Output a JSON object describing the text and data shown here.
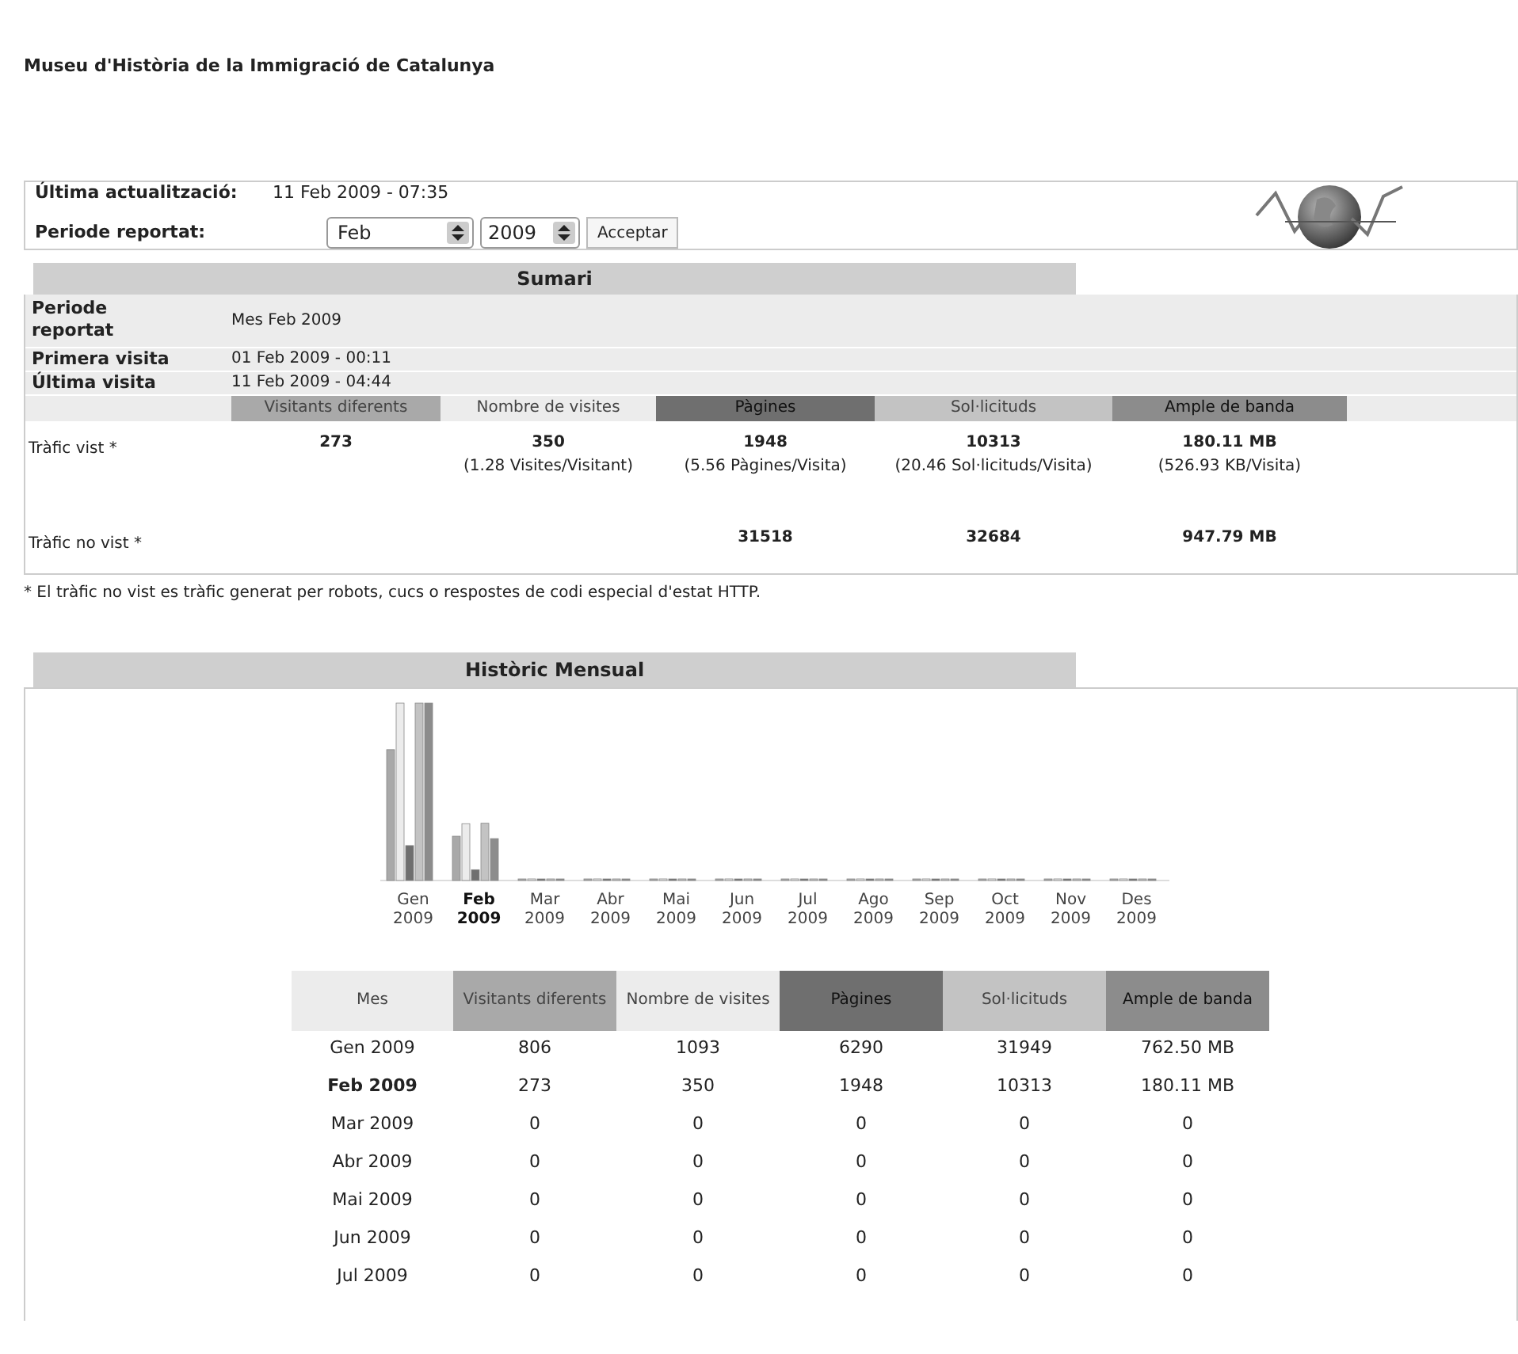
{
  "page_title": "Museu d'Història de la Immigració de Catalunya",
  "header": {
    "updated_label": "Última actualització:",
    "updated_value": "11 Feb 2009 - 07:35",
    "period_label": "Periode reportat:",
    "month_select": "Feb",
    "year_select": "2009",
    "accept_button": "Acceptar"
  },
  "summary": {
    "title": "Sumari",
    "info_rows": [
      {
        "label": "Periode reportat",
        "value": "Mes Feb 2009"
      },
      {
        "label": "Primera visita",
        "value": "01 Feb 2009 - 00:11"
      },
      {
        "label": "Última visita",
        "value": "11 Feb 2009 - 04:44"
      }
    ],
    "columns": [
      {
        "label": "Visitants diferents",
        "color": "#a9a9a9"
      },
      {
        "label": "Nombre de visites",
        "color": "#ececec"
      },
      {
        "label": "Pàgines",
        "color": "#6f6f6f"
      },
      {
        "label": "Sol·licituds",
        "color": "#c3c3c3"
      },
      {
        "label": "Ample de banda",
        "color": "#8c8c8c"
      }
    ],
    "rows": [
      {
        "label": "Tràfic vist *",
        "cells": [
          {
            "value": "273"
          },
          {
            "value": "350",
            "detail": "(1.28 Visites/Visitant)"
          },
          {
            "value": "1948",
            "detail": "(5.56 Pàgines/Visita)"
          },
          {
            "value": "10313",
            "detail": "(20.46 Sol·licituds/Visita)"
          },
          {
            "value": "180.11 MB",
            "detail": "(526.93 KB/Visita)"
          }
        ]
      },
      {
        "label": "Tràfic no vist *",
        "cells": [
          null,
          null,
          {
            "value": "31518"
          },
          {
            "value": "32684"
          },
          {
            "value": "947.79 MB"
          }
        ]
      }
    ],
    "footnote": "* El tràfic no vist es tràfic generat per robots, cucs o respostes de codi especial d'estat HTTP."
  },
  "history": {
    "title": "Històric Mensual",
    "chart_months": [
      {
        "month": "Gen",
        "year": "2009",
        "selected": false
      },
      {
        "month": "Feb",
        "year": "2009",
        "selected": true
      },
      {
        "month": "Mar",
        "year": "2009",
        "selected": false
      },
      {
        "month": "Abr",
        "year": "2009",
        "selected": false
      },
      {
        "month": "Mai",
        "year": "2009",
        "selected": false
      },
      {
        "month": "Jun",
        "year": "2009",
        "selected": false
      },
      {
        "month": "Jul",
        "year": "2009",
        "selected": false
      },
      {
        "month": "Ago",
        "year": "2009",
        "selected": false
      },
      {
        "month": "Sep",
        "year": "2009",
        "selected": false
      },
      {
        "month": "Oct",
        "year": "2009",
        "selected": false
      },
      {
        "month": "Nov",
        "year": "2009",
        "selected": false
      },
      {
        "month": "Des",
        "year": "2009",
        "selected": false
      }
    ],
    "columns": [
      {
        "label": "Mes",
        "color": "#ececec"
      },
      {
        "label": "Visitants diferents",
        "color": "#a9a9a9"
      },
      {
        "label": "Nombre de visites",
        "color": "#ececec"
      },
      {
        "label": "Pàgines",
        "color": "#6f6f6f"
      },
      {
        "label": "Sol·licituds",
        "color": "#c3c3c3"
      },
      {
        "label": "Ample de banda",
        "color": "#8c8c8c"
      }
    ],
    "rows": [
      {
        "month": "Gen 2009",
        "selected": false,
        "values": [
          "806",
          "1093",
          "6290",
          "31949",
          "762.50 MB"
        ]
      },
      {
        "month": "Feb 2009",
        "selected": true,
        "values": [
          "273",
          "350",
          "1948",
          "10313",
          "180.11 MB"
        ]
      },
      {
        "month": "Mar 2009",
        "selected": false,
        "values": [
          "0",
          "0",
          "0",
          "0",
          "0"
        ]
      },
      {
        "month": "Abr 2009",
        "selected": false,
        "values": [
          "0",
          "0",
          "0",
          "0",
          "0"
        ]
      },
      {
        "month": "Mai 2009",
        "selected": false,
        "values": [
          "0",
          "0",
          "0",
          "0",
          "0"
        ]
      },
      {
        "month": "Jun 2009",
        "selected": false,
        "values": [
          "0",
          "0",
          "0",
          "0",
          "0"
        ]
      },
      {
        "month": "Jul 2009",
        "selected": false,
        "values": [
          "0",
          "0",
          "0",
          "0",
          "0"
        ]
      }
    ]
  }
}
